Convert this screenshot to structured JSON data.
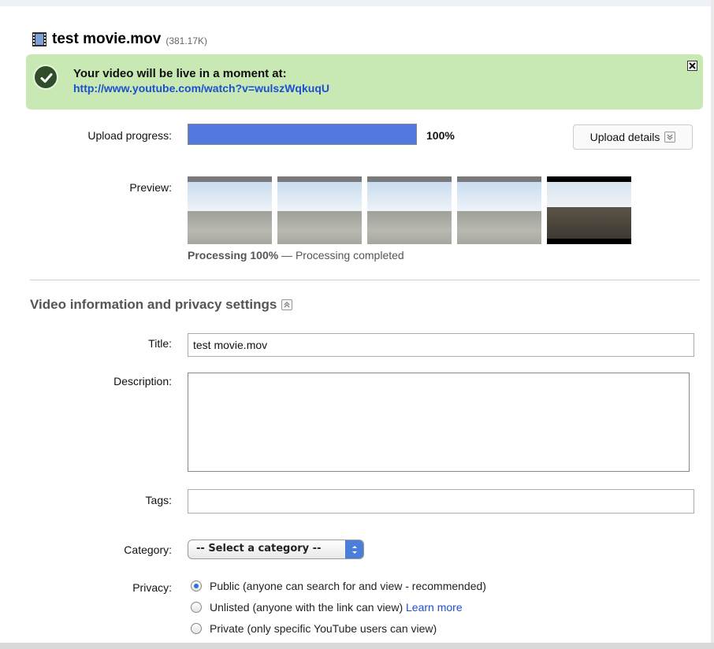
{
  "file": {
    "name": "test movie.mov",
    "size": "(381.17K)"
  },
  "notice": {
    "message": "Your video will be live in a moment at:",
    "url": "http://www.youtube.com/watch?v=wulszWqkuqU",
    "close_glyph": "×"
  },
  "upload": {
    "label": "Upload progress:",
    "progress_percent": 100,
    "progress_text": "100%",
    "details_button": "Upload details"
  },
  "preview": {
    "label": "Preview:",
    "status_bold": "Processing 100%",
    "status_rest": " — Processing completed"
  },
  "section": {
    "title": "Video information and privacy settings"
  },
  "form": {
    "title_label": "Title:",
    "title_value": "test movie.mov",
    "description_label": "Description:",
    "description_value": "",
    "tags_label": "Tags:",
    "tags_value": "",
    "category_label": "Category:",
    "category_selected": "-- Select a category --",
    "privacy_label": "Privacy:",
    "privacy_options": [
      {
        "label": "Public (anyone can search for and view - recommended)",
        "selected": true
      },
      {
        "label": "Unlisted (anyone with the link can view)",
        "link": "Learn more",
        "selected": false
      },
      {
        "label": "Private (only specific YouTube users can view)",
        "selected": false
      }
    ]
  },
  "colors": {
    "accent_blue": "#5379e0",
    "success_bg": "#c8e8b4",
    "link": "#1d4fd0"
  }
}
